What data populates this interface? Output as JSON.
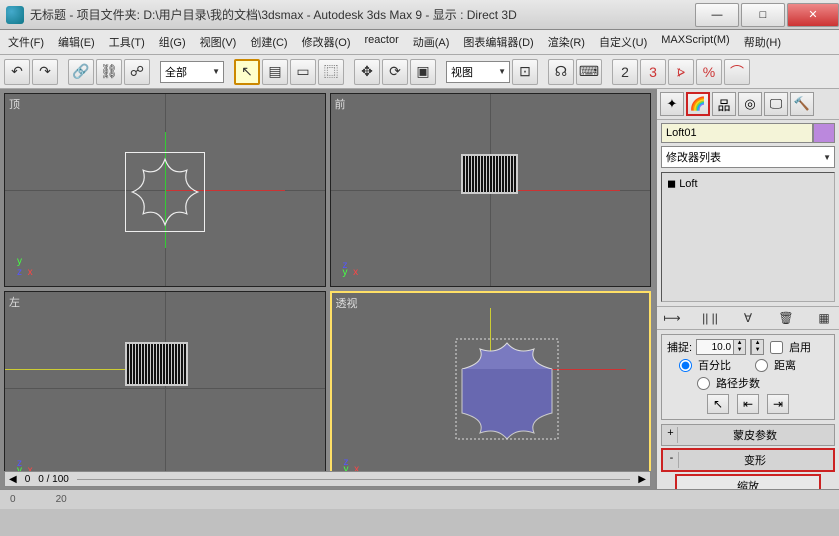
{
  "title": "无标题    - 项目文件夹: D:\\用户目录\\我的文档\\3dsmax      - Autodesk 3ds Max 9      - 显示 : Direct 3D",
  "menus": [
    "文件(F)",
    "编辑(E)",
    "工具(T)",
    "组(G)",
    "视图(V)",
    "创建(C)",
    "修改器(O)",
    "reactor",
    "动画(A)",
    "图表编辑器(D)",
    "渲染(R)",
    "自定义(U)",
    "MAXScript(M)",
    "帮助(H)"
  ],
  "toolbar": {
    "selection_filter": "全部",
    "view_label": "视图"
  },
  "viewports": {
    "top": "顶",
    "front": "前",
    "left": "左",
    "persp": "透视"
  },
  "scroll": {
    "frame": "0",
    "range": "0 / 100"
  },
  "panel": {
    "object_name": "Loft01",
    "mod_dropdown": "修改器列表",
    "mod_item": "Loft",
    "capture": "捕捉:",
    "capture_val": "10.0",
    "enable": "启用",
    "percent": "百分比",
    "distance": "距离",
    "pathsteps": "路径步数",
    "skinparams": "蒙皮参数",
    "deform": "变形",
    "scale": "缩放",
    "plus": "+",
    "minus": "-"
  },
  "timeline": {
    "t0": "0",
    "t20": "20"
  }
}
